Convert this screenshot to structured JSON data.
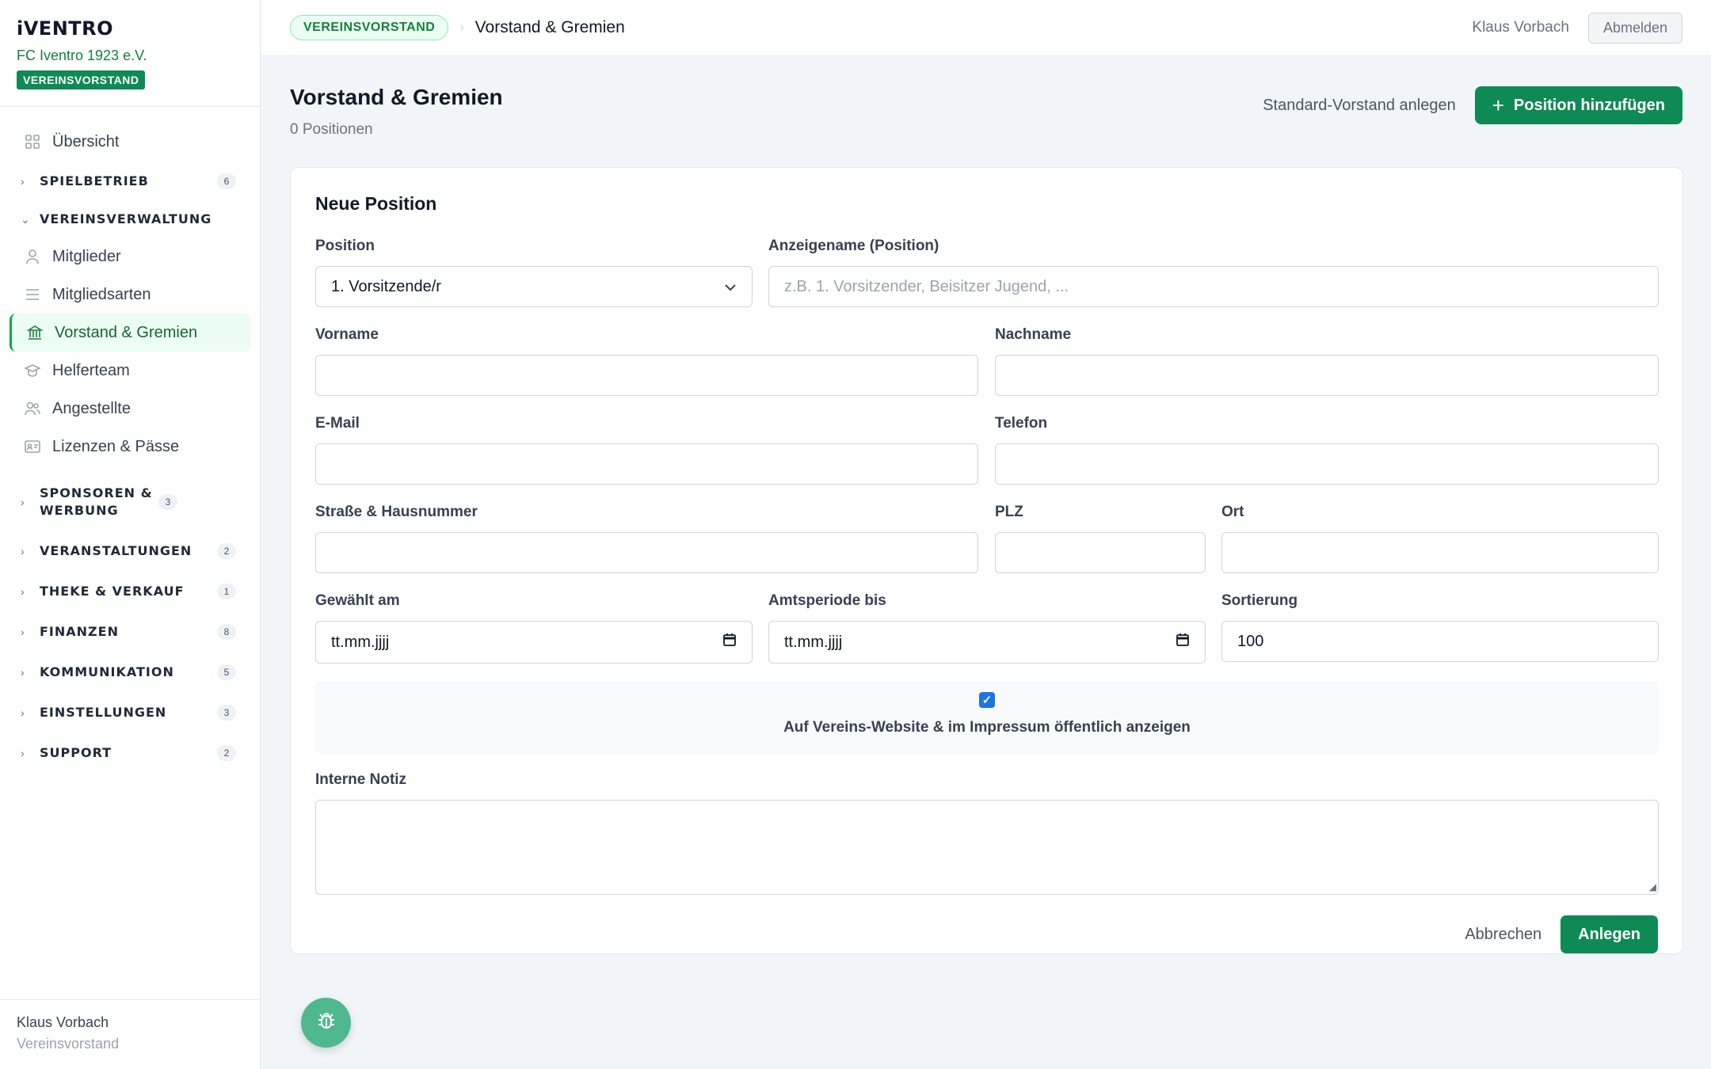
{
  "brand": {
    "logo": "iVENTRO",
    "club": "FC Iventro 1923 e.V.",
    "role": "VEREINSVORSTAND"
  },
  "sidebar": {
    "overview": "Übersicht",
    "groups": [
      {
        "label": "SPIELBETRIEB",
        "count": "6",
        "expanded": false
      },
      {
        "label": "VEREINSVERWALTUNG",
        "count": "",
        "expanded": true
      },
      {
        "label": "SPONSOREN & WERBUNG",
        "count": "3",
        "expanded": false
      },
      {
        "label": "VERANSTALTUNGEN",
        "count": "2",
        "expanded": false
      },
      {
        "label": "THEKE & VERKAUF",
        "count": "1",
        "expanded": false
      },
      {
        "label": "FINANZEN",
        "count": "8",
        "expanded": false
      },
      {
        "label": "KOMMUNIKATION",
        "count": "5",
        "expanded": false
      },
      {
        "label": "EINSTELLUNGEN",
        "count": "3",
        "expanded": false
      },
      {
        "label": "SUPPORT",
        "count": "2",
        "expanded": false
      }
    ],
    "sub_items": [
      {
        "label": "Mitglieder",
        "icon": "person-icon"
      },
      {
        "label": "Mitgliedsarten",
        "icon": "list-icon"
      },
      {
        "label": "Vorstand & Gremien",
        "icon": "bank-icon",
        "active": true
      },
      {
        "label": "Helferteam",
        "icon": "graduation-cap-icon"
      },
      {
        "label": "Angestellte",
        "icon": "users-icon"
      },
      {
        "label": "Lizenzen & Pässe",
        "icon": "id-card-icon"
      }
    ],
    "footer": {
      "name": "Klaus Vorbach",
      "role": "Vereinsvorstand"
    }
  },
  "topbar": {
    "badge": "VEREINSVORSTAND",
    "separator": "›",
    "title": "Vorstand & Gremien",
    "user": "Klaus Vorbach",
    "logout": "Abmelden"
  },
  "page": {
    "title": "Vorstand & Gremien",
    "subtitle": "0 Positionen",
    "secondary_action": "Standard-Vorstand anlegen",
    "primary_action": "Position hinzufügen"
  },
  "form": {
    "title": "Neue Position",
    "position": {
      "label": "Position",
      "value": "1. Vorsitzende/r"
    },
    "display_name": {
      "label": "Anzeigename (Position)",
      "placeholder": "z.B. 1. Vorsitzender, Beisitzer Jugend, ..."
    },
    "first_name": {
      "label": "Vorname",
      "value": ""
    },
    "last_name": {
      "label": "Nachname",
      "value": ""
    },
    "email": {
      "label": "E-Mail",
      "value": ""
    },
    "phone": {
      "label": "Telefon",
      "value": ""
    },
    "street": {
      "label": "Straße & Hausnummer",
      "value": ""
    },
    "zip": {
      "label": "PLZ",
      "value": ""
    },
    "city": {
      "label": "Ort",
      "value": ""
    },
    "elected": {
      "label": "Gewählt am",
      "value": "tt.mm.jjjj"
    },
    "term_end": {
      "label": "Amtsperiode bis",
      "value": "tt.mm.jjjj"
    },
    "sort": {
      "label": "Sortierung",
      "value": "100"
    },
    "public": {
      "label": "Auf Vereins-Website & im Impressum öffentlich anzeigen",
      "checked": true
    },
    "note": {
      "label": "Interne Notiz",
      "value": ""
    },
    "cancel": "Abbrechen",
    "submit": "Anlegen"
  },
  "colors": {
    "accent": "#0f8a54",
    "checkbox": "#1a73e8"
  }
}
